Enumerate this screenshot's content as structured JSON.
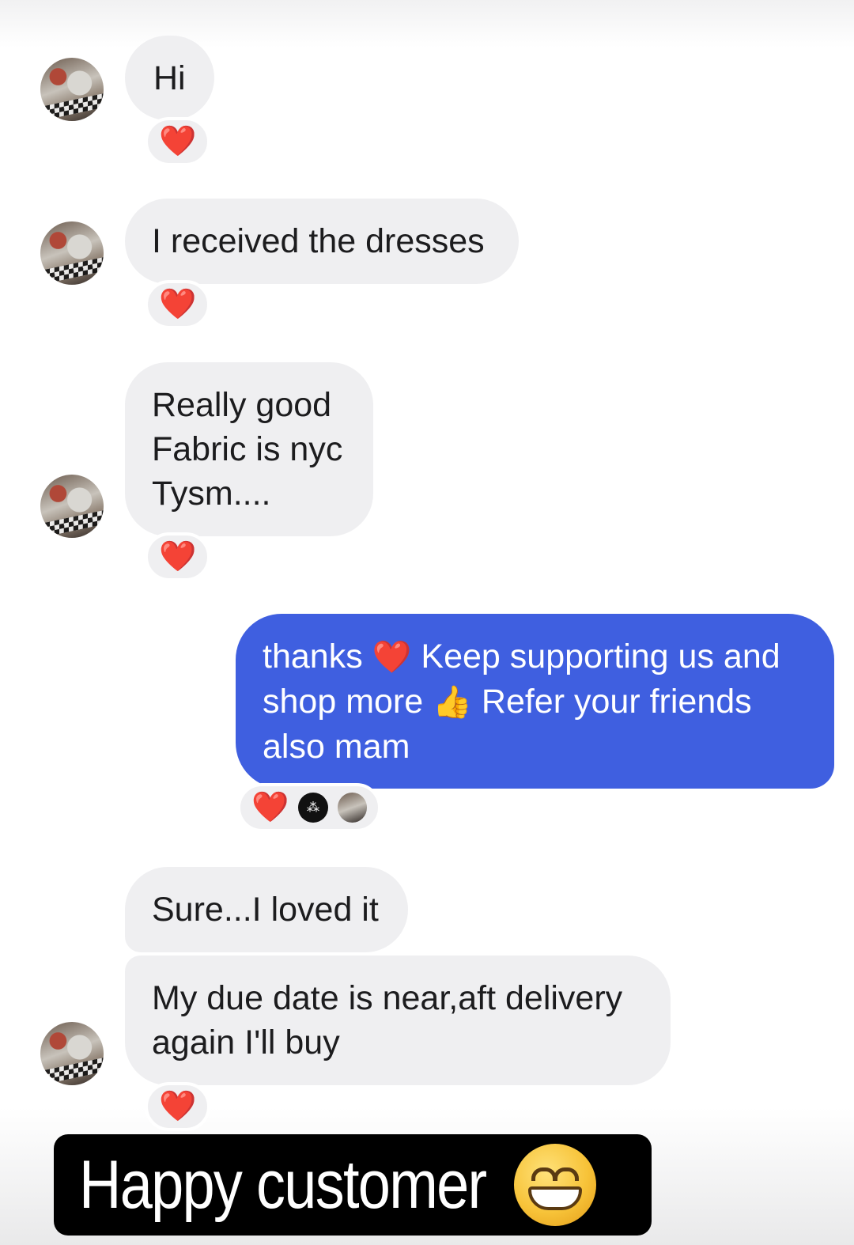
{
  "messages": [
    {
      "text": "Hi",
      "reaction": "❤️"
    },
    {
      "text": "I received the dresses",
      "reaction": "❤️"
    },
    {
      "lines": [
        "Really good",
        "Fabric is nyc",
        "Tysm...."
      ],
      "reaction": "❤️"
    },
    {
      "lines": [
        "thanks",
        "Keep supporting us and",
        "shop more",
        "Refer your friends",
        "also mam"
      ],
      "emojis": [
        "❤️",
        "👍"
      ],
      "reactions": [
        "❤️"
      ]
    },
    {
      "text": "Sure...I loved it"
    },
    {
      "lines": [
        "My due date is near,aft delivery",
        "again I'll buy"
      ],
      "reaction": "❤️"
    }
  ],
  "banner": {
    "text": "Happy customer",
    "emoji": "😁"
  },
  "colors": {
    "sent_bubble": "#3f5fe0",
    "received_bubble": "#efeff1",
    "heart": "#f0355f"
  }
}
